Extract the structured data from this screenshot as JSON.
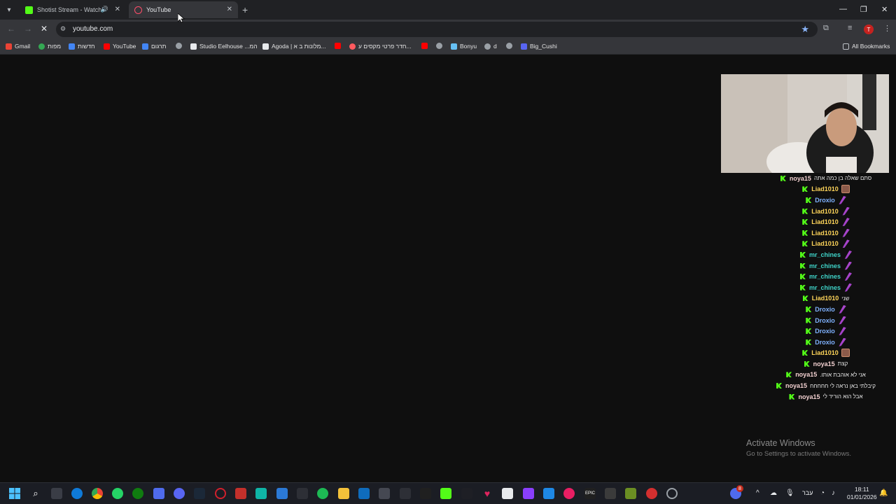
{
  "browser": {
    "tabs": [
      {
        "title": "Shotist Stream - Watch Live",
        "favicon_color": "#53fc18",
        "active": false
      },
      {
        "title": "YouTube",
        "favicon_color": "#ff0033",
        "active": true
      }
    ],
    "url": "youtube.com",
    "profile_initial": "T",
    "bookmarks": [
      {
        "label": "Gmail",
        "icon_color": "#ea4335"
      },
      {
        "label": "מפות",
        "icon_color": "#34a853"
      },
      {
        "label": "חדשות",
        "icon_color": "#4285f4"
      },
      {
        "label": "YouTube",
        "icon_color": "#ff0000"
      },
      {
        "label": "תרגום",
        "icon_color": "#4285f4"
      },
      {
        "label": "",
        "icon_color": "#9aa0a6"
      },
      {
        "label": "Studio Eelhouse ...המ",
        "icon_color": "#e8eaed"
      },
      {
        "label": "Agoda | מלונות ב א...",
        "icon_color": "#e8eaed"
      },
      {
        "label": "",
        "icon_color": "#ff0000"
      },
      {
        "label": "חדר פרטי מקסים ע...",
        "icon_color": "#ff5a5f"
      },
      {
        "label": "",
        "icon_color": "#ff0000"
      },
      {
        "label": "",
        "icon_color": "#9aa0a6"
      },
      {
        "label": "Bonyu",
        "icon_color": "#66c0f4"
      },
      {
        "label": "d",
        "icon_color": "#9aa0a6"
      },
      {
        "label": "",
        "icon_color": "#9aa0a6"
      },
      {
        "label": "Big_Cushi",
        "icon_color": "#5865f2"
      }
    ],
    "all_bookmarks": "All Bookmarks"
  },
  "chat": {
    "messages": [
      {
        "user": "noya15",
        "color": "#f2d0d0",
        "text": "סתם שאלה בן כמה אתה",
        "emote": ""
      },
      {
        "user": "Liad1010",
        "color": "#ffd55a",
        "text": "",
        "emote": "pic"
      },
      {
        "user": "Droxio",
        "color": "#7fb2ff",
        "text": "",
        "emote": "feather"
      },
      {
        "user": "Liad1010",
        "color": "#ffd55a",
        "text": "",
        "emote": "feather"
      },
      {
        "user": "Liad1010",
        "color": "#ffd55a",
        "text": "",
        "emote": "feather"
      },
      {
        "user": "Liad1010",
        "color": "#ffd55a",
        "text": "",
        "emote": "feather"
      },
      {
        "user": "Liad1010",
        "color": "#ffd55a",
        "text": "",
        "emote": "feather"
      },
      {
        "user": "mr_chines",
        "color": "#3fd3c8",
        "text": "",
        "emote": "feather"
      },
      {
        "user": "mr_chines",
        "color": "#3fd3c8",
        "text": "",
        "emote": "feather"
      },
      {
        "user": "mr_chines",
        "color": "#3fd3c8",
        "text": "",
        "emote": "feather"
      },
      {
        "user": "mr_chines",
        "color": "#3fd3c8",
        "text": "",
        "emote": "feather"
      },
      {
        "user": "Liad1010",
        "color": "#ffd55a",
        "text": "שני",
        "emote": ""
      },
      {
        "user": "Droxio",
        "color": "#7fb2ff",
        "text": "",
        "emote": "feather"
      },
      {
        "user": "Droxio",
        "color": "#7fb2ff",
        "text": "",
        "emote": "feather"
      },
      {
        "user": "Droxio",
        "color": "#7fb2ff",
        "text": "",
        "emote": "feather"
      },
      {
        "user": "Droxio",
        "color": "#7fb2ff",
        "text": "",
        "emote": "feather"
      },
      {
        "user": "Liad1010",
        "color": "#ffd55a",
        "text": "",
        "emote": "pic"
      },
      {
        "user": "noya15",
        "color": "#f2d0d0",
        "text": "קצת",
        "emote": ""
      },
      {
        "user": "noya15",
        "color": "#f2d0d0",
        "text": ".אני לא אוהבת אותו",
        "emote": ""
      },
      {
        "user": "noya15",
        "color": "#f2d0d0",
        "text": "קיבלתי באן נראה לי חחחחח",
        "emote": ""
      },
      {
        "user": "noya15",
        "color": "#f2d0d0",
        "text": "אבל הוא הוריד לי",
        "emote": ""
      }
    ]
  },
  "watermark": {
    "title": "Activate Windows",
    "subtitle": "Go to Settings to activate Windows."
  },
  "taskbar": {
    "language": "עבר",
    "time": "18:11",
    "date": "01/01/2026",
    "notification_count": "8"
  }
}
